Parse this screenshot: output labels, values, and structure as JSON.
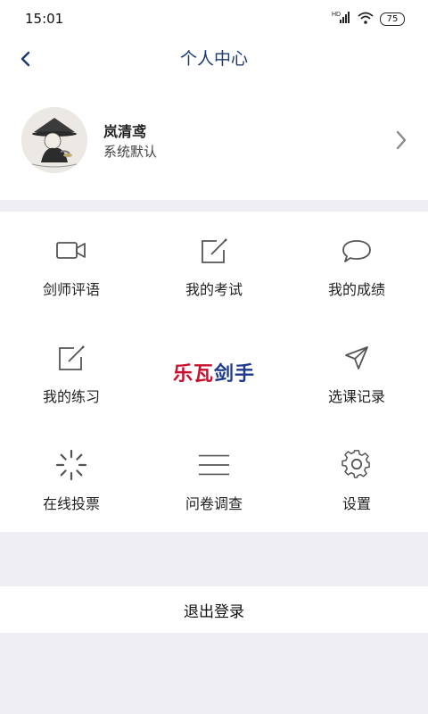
{
  "status": {
    "time": "15:01",
    "network": "HD",
    "battery": "75"
  },
  "nav": {
    "title": "个人中心"
  },
  "profile": {
    "name": "岚清鸢",
    "subtitle": "系统默认"
  },
  "grid": {
    "items": [
      {
        "label": "剑师评语",
        "icon": "video-camera-icon"
      },
      {
        "label": "我的考试",
        "icon": "edit-pencil-icon"
      },
      {
        "label": "我的成绩",
        "icon": "chat-bubble-icon"
      },
      {
        "label": "我的练习",
        "icon": "edit-pencil-icon"
      },
      {
        "label": "选课记录",
        "icon": "send-arrow-icon"
      },
      {
        "label": "在线投票",
        "icon": "loading-spinner-icon"
      },
      {
        "label": "问卷调查",
        "icon": "menu-lines-icon"
      },
      {
        "label": "设置",
        "icon": "gear-icon"
      }
    ],
    "brand": {
      "part1": "乐瓦",
      "part2": "剑手"
    }
  },
  "logout": {
    "label": "退出登录"
  },
  "colors": {
    "title": "#1d3a6e",
    "brand_red": "#c8102e",
    "brand_blue": "#1e3a8a",
    "background": "#efeef3"
  }
}
